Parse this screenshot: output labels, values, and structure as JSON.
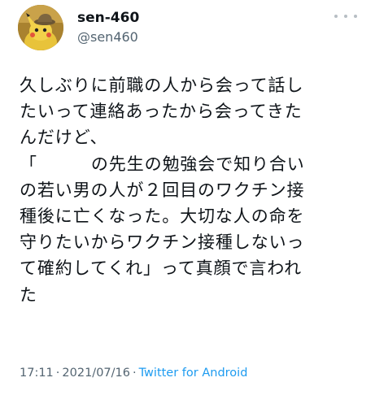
{
  "tweet": {
    "author": {
      "display_name": "sen-460",
      "handle": "@sen460"
    },
    "text_lines": [
      "久しぶりに前職の人から会って話し",
      "たいって連絡あったから会ってきた",
      "んだけど、",
      "「",
      "の先生の勉強会で知り合い",
      "の若い男の人が２回目のワクチン接",
      "種後に亡くなった。大切な人の命を",
      "守りたいからワクチン接種しないっ",
      "て確約してくれ」って真顔で言われ",
      "た"
    ],
    "time": "17:11",
    "date": "2021/07/16",
    "separator": "·",
    "source": "Twitter for Android"
  },
  "colors": {
    "text": "#0f1419",
    "secondary": "#536471",
    "link": "#1d9bf0",
    "avatar_bg": "#b48a2f"
  },
  "icons": {
    "more": "more-horizontal-icon",
    "avatar": "pikachu-detective-avatar"
  }
}
